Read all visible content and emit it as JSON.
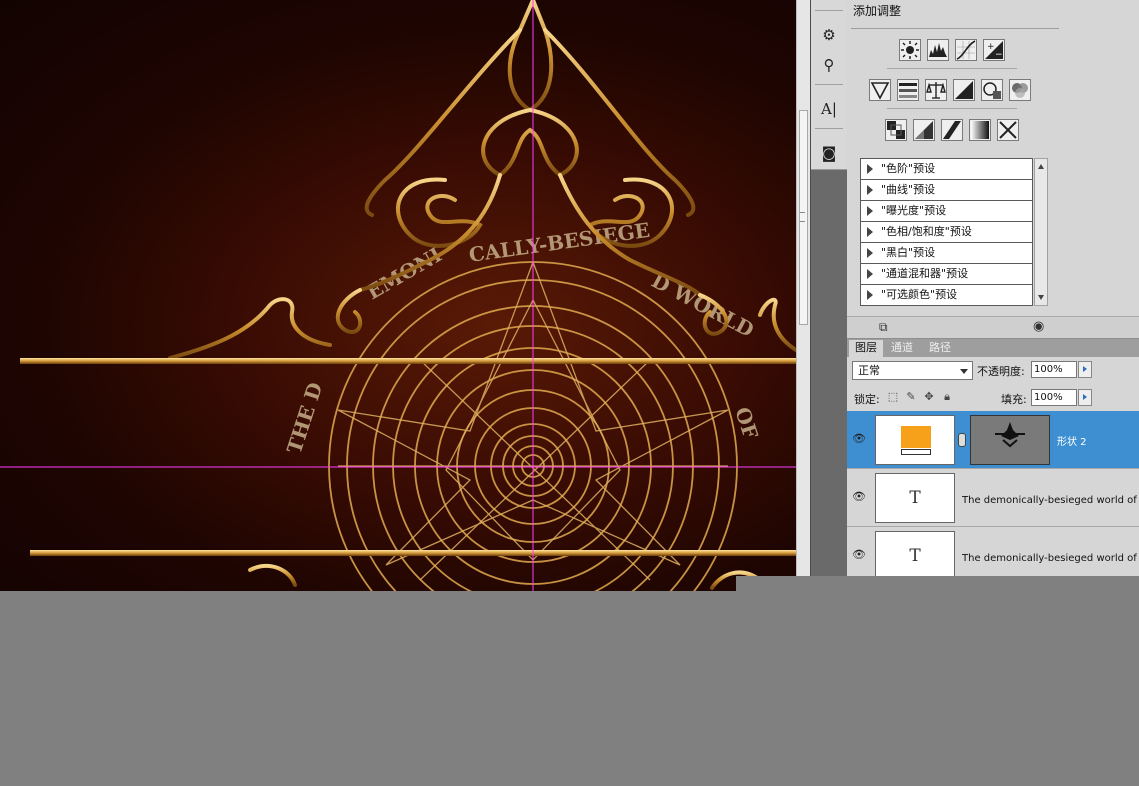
{
  "adjustments": {
    "title": "添加调整",
    "icons_row1": [
      "brightness-contrast-icon",
      "levels-icon",
      "curves-icon",
      "exposure-icon"
    ],
    "icons_row2": [
      "vibrance-icon",
      "hue-saturation-icon",
      "color-balance-icon",
      "black-white-icon",
      "photo-filter-icon",
      "channel-mixer-icon"
    ],
    "icons_row3": [
      "invert-icon",
      "posterize-icon",
      "threshold-icon",
      "gradient-map-icon",
      "selective-color-icon"
    ],
    "presets": [
      "\"色阶\"预设",
      "\"曲线\"预设",
      "\"曝光度\"预设",
      "\"色相/饱和度\"预设",
      "\"黑白\"预设",
      "\"通道混和器\"预设",
      "\"可选颜色\"预设"
    ]
  },
  "layers": {
    "tabs": [
      "图层",
      "通道",
      "路径"
    ],
    "blend_mode": "正常",
    "opacity_label": "不透明度:",
    "opacity_value": "100%",
    "lock_label": "锁定:",
    "fill_label": "填充:",
    "fill_value": "100%",
    "items": [
      {
        "name": "形状 2",
        "type": "shape",
        "selected": true,
        "color": "#f7a01a"
      },
      {
        "name": "The demonically-besieged world of 墨",
        "type": "text",
        "selected": false
      },
      {
        "name": "The demonically-besieged world of 墨",
        "type": "text",
        "selected": false
      }
    ]
  },
  "artwork": {
    "ring_text": "THE DEMONICALLY-BESIEGED WORLD OF",
    "accent": "#d7a043",
    "guide_color": "#ff3cff"
  }
}
